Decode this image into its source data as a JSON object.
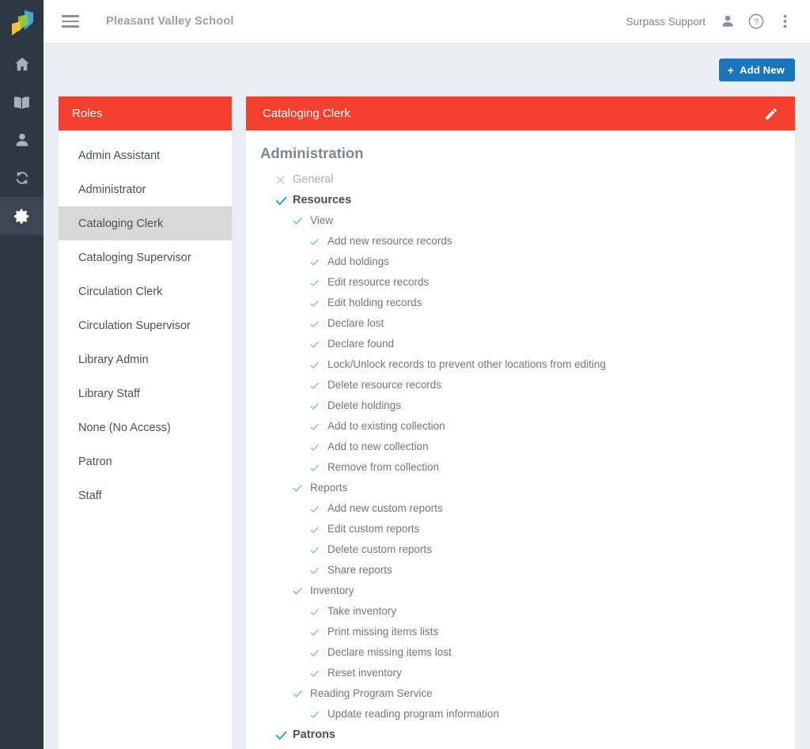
{
  "colors": {
    "rail_bg": "#2e3842",
    "rail_active": "#3b4653",
    "panel_red": "#f4402f",
    "accent_blue": "#1a76bc",
    "check_strong": "#2196f3",
    "check_light": "#56b4ef",
    "page_bg": "#eaeef2"
  },
  "rail": {
    "logo_name": "surpass-logo",
    "items": [
      {
        "name": "home-icon",
        "label": "Home",
        "active": false
      },
      {
        "name": "book-icon",
        "label": "Catalog",
        "active": false
      },
      {
        "name": "person-icon",
        "label": "Patrons",
        "active": false
      },
      {
        "name": "sync-icon",
        "label": "Circulation",
        "active": false
      },
      {
        "name": "gear-icon",
        "label": "Settings",
        "active": true
      }
    ]
  },
  "topbar": {
    "menu_icon": "hamburger-icon",
    "title": "Pleasant Valley School",
    "user_name": "Surpass Support",
    "user_icon": "person-icon",
    "help_icon": "help-circle-icon",
    "overflow_icon": "kebab-menu-icon"
  },
  "toolbar": {
    "add_new_plus": "+",
    "add_new_label": "Add New"
  },
  "roles_panel": {
    "header": "Roles",
    "selected": "Cataloging Clerk",
    "items": [
      "Admin Assistant",
      "Administrator",
      "Cataloging Clerk",
      "Cataloging Supervisor",
      "Circulation Clerk",
      "Circulation Supervisor",
      "Library Admin",
      "Library Staff",
      "None (No Access)",
      "Patron",
      "Staff"
    ]
  },
  "detail_panel": {
    "header": "Cataloging Clerk",
    "edit_icon": "pencil-icon",
    "section_title": "Administration",
    "nodes": [
      {
        "label": "General",
        "level": 1,
        "state": "off"
      },
      {
        "label": "Resources",
        "level": 1,
        "state": "on"
      },
      {
        "label": "View",
        "level": 2,
        "state": "on"
      },
      {
        "label": "Add new resource records",
        "level": 3,
        "state": "on"
      },
      {
        "label": "Add holdings",
        "level": 3,
        "state": "on"
      },
      {
        "label": "Edit resource records",
        "level": 3,
        "state": "on"
      },
      {
        "label": "Edit holding records",
        "level": 3,
        "state": "on"
      },
      {
        "label": "Declare lost",
        "level": 3,
        "state": "on"
      },
      {
        "label": "Declare found",
        "level": 3,
        "state": "on"
      },
      {
        "label": "Lock/Unlock records to prevent other locations from editing",
        "level": 3,
        "state": "on"
      },
      {
        "label": "Delete resource records",
        "level": 3,
        "state": "on"
      },
      {
        "label": "Delete holdings",
        "level": 3,
        "state": "on"
      },
      {
        "label": "Add to existing collection",
        "level": 3,
        "state": "on"
      },
      {
        "label": "Add to new collection",
        "level": 3,
        "state": "on"
      },
      {
        "label": "Remove from collection",
        "level": 3,
        "state": "on"
      },
      {
        "label": "Reports",
        "level": 2,
        "state": "on"
      },
      {
        "label": "Add new custom reports",
        "level": 3,
        "state": "on"
      },
      {
        "label": "Edit custom reports",
        "level": 3,
        "state": "on"
      },
      {
        "label": "Delete custom reports",
        "level": 3,
        "state": "on"
      },
      {
        "label": "Share reports",
        "level": 3,
        "state": "on"
      },
      {
        "label": "Inventory",
        "level": 2,
        "state": "on"
      },
      {
        "label": "Take inventory",
        "level": 3,
        "state": "on"
      },
      {
        "label": "Print missing items lists",
        "level": 3,
        "state": "on"
      },
      {
        "label": "Declare missing items lost",
        "level": 3,
        "state": "on"
      },
      {
        "label": "Reset inventory",
        "level": 3,
        "state": "on"
      },
      {
        "label": "Reading Program Service",
        "level": 2,
        "state": "on"
      },
      {
        "label": "Update reading program information",
        "level": 3,
        "state": "on"
      },
      {
        "label": "Patrons",
        "level": 1,
        "state": "on"
      }
    ]
  }
}
